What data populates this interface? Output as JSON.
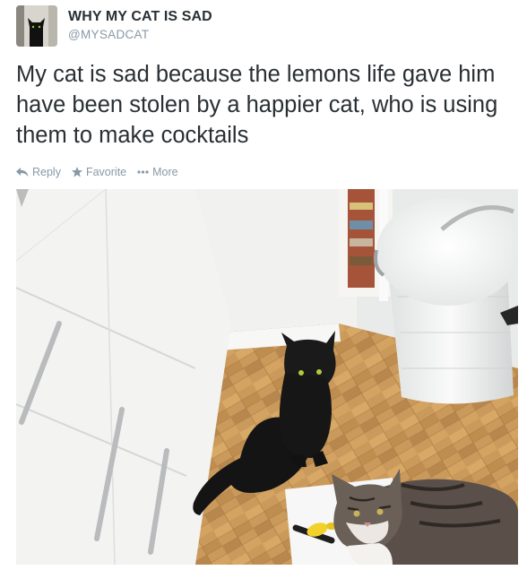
{
  "tweet": {
    "display_name": "WHY MY CAT IS SAD",
    "handle": "@MYSADCAT",
    "text": "My cat is sad because the lemons life gave him have been stolen by a happier cat, who is using them to make cocktails",
    "actions": [
      {
        "label": "Reply",
        "icon": "reply-icon"
      },
      {
        "label": "Favorite",
        "icon": "star-icon"
      },
      {
        "label": "More",
        "icon": "ellipsis-icon"
      }
    ],
    "colors": {
      "text": "#292f33",
      "muted": "#8899a6"
    }
  },
  "photo": {
    "subject": "black-cat-and-tabby-cat-in-kitchen"
  }
}
